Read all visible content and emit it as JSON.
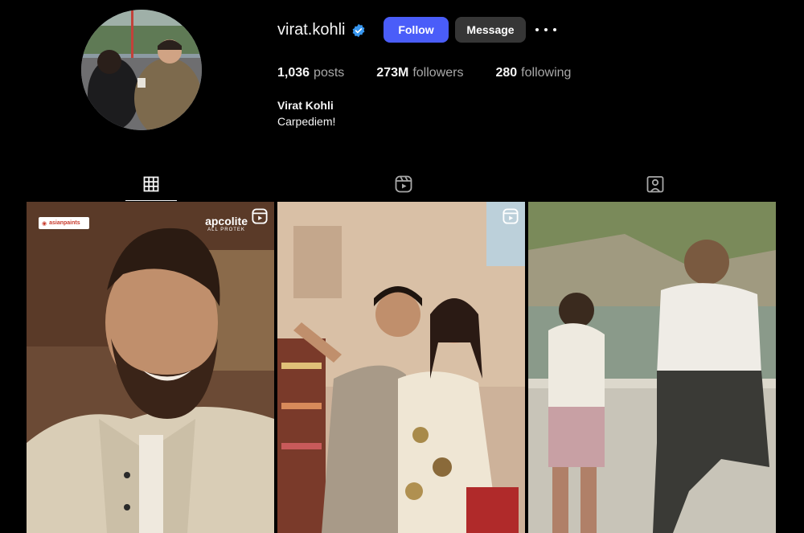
{
  "profile": {
    "username": "virat.kohli",
    "full_name": "Virat Kohli",
    "bio": "Carpediem!",
    "verified": true
  },
  "buttons": {
    "follow": "Follow",
    "message": "Message"
  },
  "stats": {
    "posts_count": "1,036",
    "posts_label": "posts",
    "followers_count": "273M",
    "followers_label": "followers",
    "following_count": "280",
    "following_label": "following"
  },
  "tabs": [
    {
      "name": "posts",
      "icon": "grid-icon",
      "active": true
    },
    {
      "name": "reels",
      "icon": "reels-icon",
      "active": false
    },
    {
      "name": "tagged",
      "icon": "tagged-icon",
      "active": false
    }
  ],
  "posts": [
    {
      "type": "reel",
      "brand_left": "asianpaints",
      "brand_right_title": "apcolite",
      "brand_right_sub": "ALL PROTEK"
    },
    {
      "type": "reel"
    },
    {
      "type": "photo"
    }
  ],
  "colors": {
    "background": "#000000",
    "follow_button": "#4a5df9",
    "message_button": "#363636",
    "verified": "#3897f0",
    "secondary_text": "#a8a8a8"
  }
}
